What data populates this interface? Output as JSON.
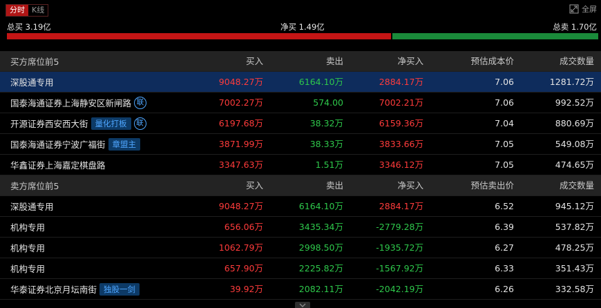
{
  "tabs": [
    {
      "label": "分时",
      "active": true
    },
    {
      "label": "K线",
      "active": false
    }
  ],
  "fullscreen_label": "全屏",
  "summary": {
    "total_buy": "总买 3.19亿",
    "net_buy": "净买 1.49亿",
    "total_sell": "总卖 1.70亿"
  },
  "flow_bar": {
    "buy_fraction": 0.652,
    "sell_fraction": 0.348
  },
  "buy_section": {
    "header": {
      "name": "买方席位前5",
      "buy": "买入",
      "sell": "卖出",
      "net": "净买入",
      "price": "预估成本价",
      "volume": "成交数量"
    },
    "rows": [
      {
        "name": "深股通专用",
        "tag": "",
        "lian": "",
        "buy": "9048.27万",
        "sell": "6164.10万",
        "net": "2884.17万",
        "price": "7.06",
        "volume": "1281.72万"
      },
      {
        "name": "国泰海通证券上海静安区新闸路",
        "tag": "",
        "lian": "联",
        "buy": "7002.27万",
        "sell": "574.00",
        "net": "7002.21万",
        "price": "7.06",
        "volume": "992.52万"
      },
      {
        "name": "开源证券西安西大街",
        "tag": "量化打板",
        "lian": "联",
        "buy": "6197.68万",
        "sell": "38.32万",
        "net": "6159.36万",
        "price": "7.04",
        "volume": "880.69万"
      },
      {
        "name": "国泰海通证券宁波广福街",
        "tag": "章盟主",
        "lian": "",
        "buy": "3871.99万",
        "sell": "38.33万",
        "net": "3833.66万",
        "price": "7.05",
        "volume": "549.08万"
      },
      {
        "name": "华鑫证券上海嘉定棋盘路",
        "tag": "",
        "lian": "",
        "buy": "3347.63万",
        "sell": "1.51万",
        "net": "3346.12万",
        "price": "7.05",
        "volume": "474.65万"
      }
    ]
  },
  "sell_section": {
    "header": {
      "name": "卖方席位前5",
      "buy": "买入",
      "sell": "卖出",
      "net": "净买入",
      "price": "预估卖出价",
      "volume": "成交数量"
    },
    "rows": [
      {
        "name": "深股通专用",
        "tag": "",
        "lian": "",
        "buy": "9048.27万",
        "sell": "6164.10万",
        "net": "2884.17万",
        "price": "6.52",
        "volume": "945.12万"
      },
      {
        "name": "机构专用",
        "tag": "",
        "lian": "",
        "buy": "656.06万",
        "sell": "3435.34万",
        "net": "-2779.28万",
        "price": "6.39",
        "volume": "537.82万"
      },
      {
        "name": "机构专用",
        "tag": "",
        "lian": "",
        "buy": "1062.79万",
        "sell": "2998.50万",
        "net": "-1935.72万",
        "price": "6.27",
        "volume": "478.25万"
      },
      {
        "name": "机构专用",
        "tag": "",
        "lian": "",
        "buy": "657.90万",
        "sell": "2225.82万",
        "net": "-1567.92万",
        "price": "6.33",
        "volume": "351.43万"
      },
      {
        "name": "华泰证券北京月坛南街",
        "tag": "独股一剑",
        "lian": "",
        "buy": "39.92万",
        "sell": "2082.11万",
        "net": "-2042.19万",
        "price": "6.26",
        "volume": "332.58万"
      }
    ]
  },
  "colors": {
    "buy": "#ff3b3b",
    "sell": "#2ec84b",
    "highlight": "#0e2c5c",
    "tag_bg": "#0d3a66",
    "tag_text": "#4ea6ff"
  }
}
